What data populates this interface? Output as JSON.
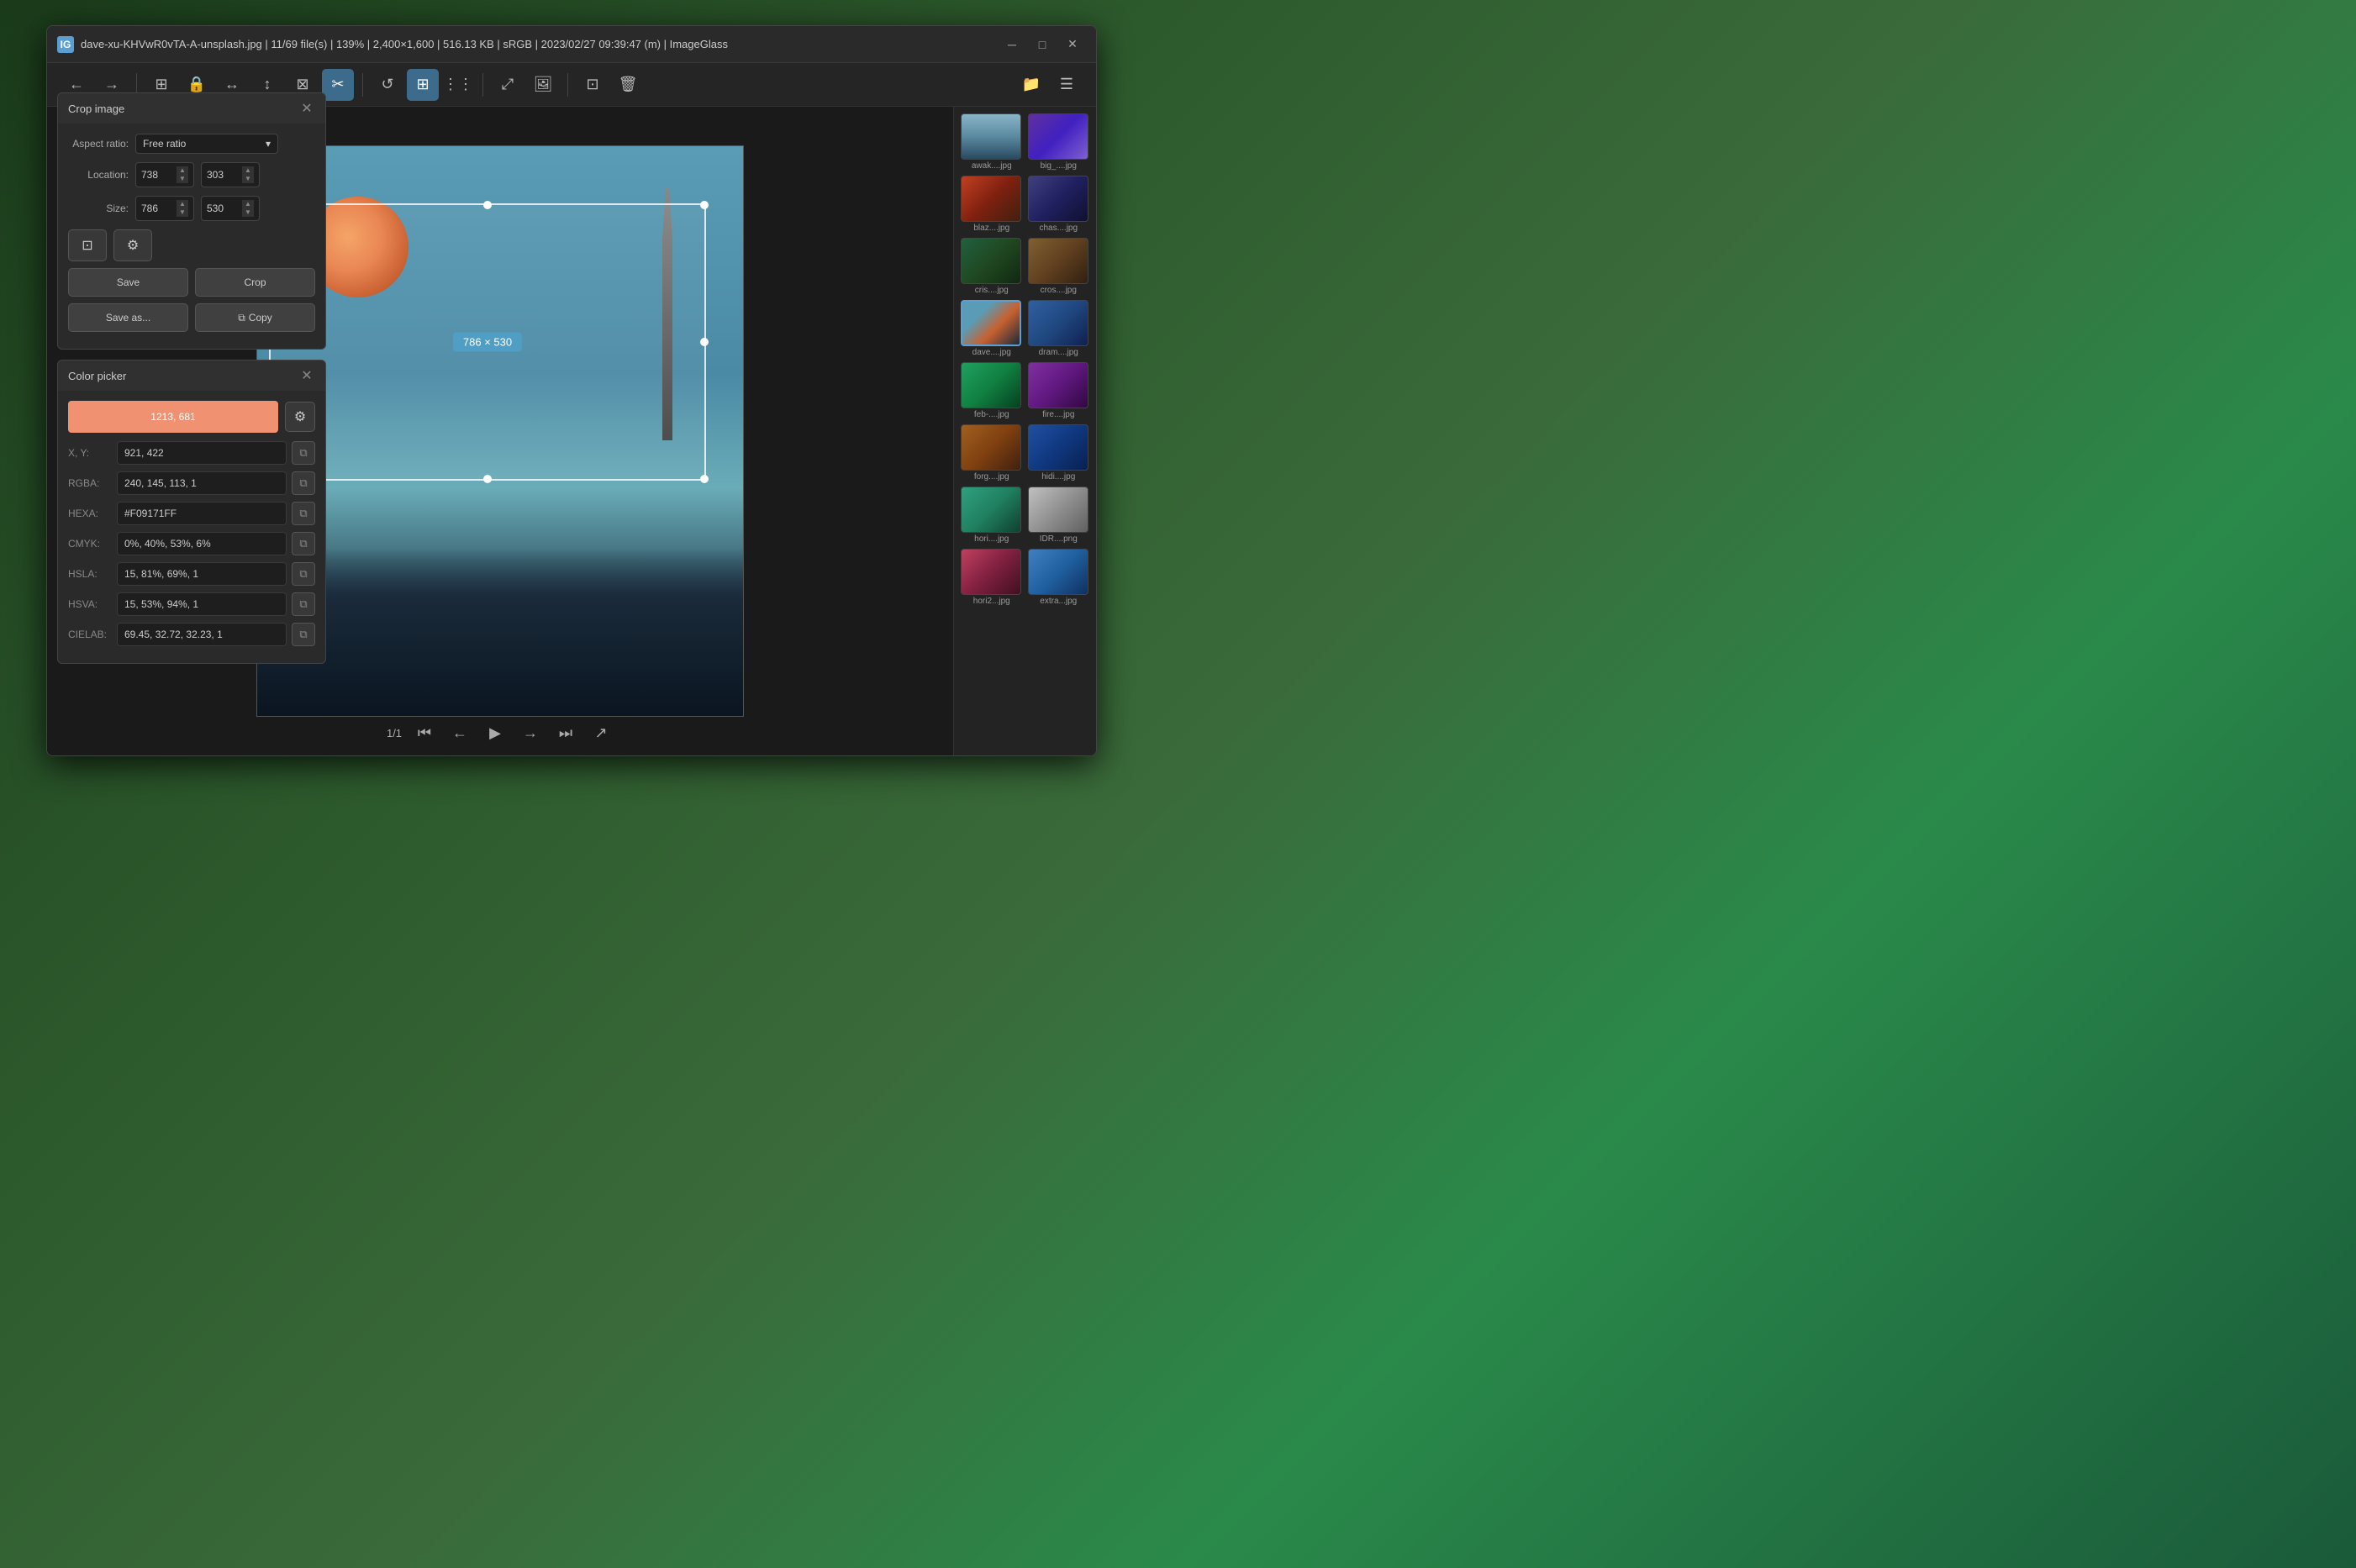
{
  "window": {
    "title": "dave-xu-KHVwR0vTA-A-unsplash.jpg  |  11/69 file(s)  |  139%  |  2,400×1,600  |  516.13 KB  |  sRGB  |  2023/02/27 09:39:47 (m)  |  ImageGlass",
    "icon_label": "IG"
  },
  "toolbar": {
    "back_label": "←",
    "forward_label": "→",
    "btn1": "⊞",
    "btn2": "🔒",
    "btn3": "⊡",
    "btn4": "⊟",
    "btn5": "⊠",
    "btn6": "✂",
    "btn7": "↺",
    "btn8_active": "⊞",
    "btn9": "⋮⋮",
    "btn10": "⤢",
    "btn11": "🖼",
    "btn12": "⊡",
    "btn13": "🗑",
    "btn14": "📁",
    "btn15": "☰"
  },
  "crop_panel": {
    "title": "Crop image",
    "aspect_ratio_label": "Aspect ratio:",
    "aspect_ratio_value": "Free ratio",
    "location_label": "Location:",
    "location_x": "738",
    "location_y": "303",
    "size_label": "Size:",
    "size_w": "786",
    "size_h": "530",
    "save_label": "Save",
    "crop_label": "Crop",
    "save_as_label": "Save as...",
    "copy_label": "Copy",
    "crop_size_display": "786 × 530"
  },
  "color_picker": {
    "title": "Color picker",
    "position": "1213, 681",
    "xy_label": "X, Y:",
    "xy_value": "921, 422",
    "rgba_label": "RGBA:",
    "rgba_value": "240, 145, 113, 1",
    "hexa_label": "HEXA:",
    "hexa_value": "#F09171FF",
    "cmyk_label": "CMYK:",
    "cmyk_value": "0%, 40%, 53%, 6%",
    "hsla_label": "HSLA:",
    "hsla_value": "15, 81%, 69%, 1",
    "hsva_label": "HSVA:",
    "hsva_value": "15, 53%, 94%, 1",
    "cielab_label": "CIELAB:",
    "cielab_value": "69.45, 32.72, 32.23, 1",
    "color_hex": "#F09171"
  },
  "thumbnails": [
    {
      "label": "awak....jpg",
      "color_class": "t1"
    },
    {
      "label": "big_....jpg",
      "color_class": "t2"
    },
    {
      "label": "blaz....jpg",
      "color_class": "t3"
    },
    {
      "label": "chas....jpg",
      "color_class": "t4"
    },
    {
      "label": "cris....jpg",
      "color_class": "t5"
    },
    {
      "label": "cros....jpg",
      "color_class": "t6"
    },
    {
      "label": "dave....jpg",
      "color_class": "t7",
      "active": true
    },
    {
      "label": "dram....jpg",
      "color_class": "t8"
    },
    {
      "label": "feb-....jpg",
      "color_class": "t9"
    },
    {
      "label": "fire....jpg",
      "color_class": "t10"
    },
    {
      "label": "forg....jpg",
      "color_class": "t11"
    },
    {
      "label": "hidi....jpg",
      "color_class": "t12"
    },
    {
      "label": "hori....jpg",
      "color_class": "t13"
    },
    {
      "label": "IDR....png",
      "color_class": "t14"
    },
    {
      "label": "hori2...jpg",
      "color_class": "t15"
    },
    {
      "label": "extra...jpg",
      "color_class": "t16"
    }
  ],
  "bottom_nav": {
    "page_indicator": "1/1",
    "first_label": "⏮",
    "prev_label": "←",
    "play_label": "▶",
    "next_label": "→",
    "last_label": "⏭",
    "export_label": "↗"
  },
  "status": {
    "file_position": "11/69 file(s)",
    "zoom": "139%",
    "dimensions": "2,400×1,600",
    "filesize": "516.13 KB",
    "colorspace": "sRGB",
    "datetime": "2023/02/27 09:39:47 (m)",
    "app": "ImageGlass"
  }
}
